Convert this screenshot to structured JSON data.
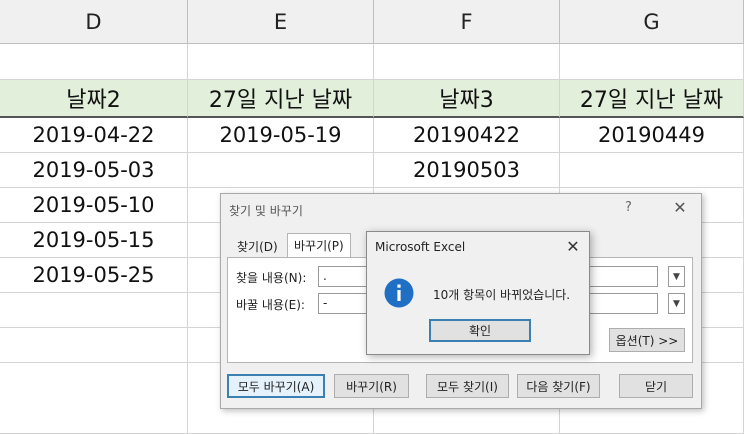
{
  "sheet": {
    "columns": [
      "D",
      "E",
      "F",
      "G"
    ],
    "headers": [
      "날짜2",
      "27일 지난 날짜",
      "날짜3",
      "27일 지난 날짜"
    ],
    "rows": [
      [
        "2019-04-22",
        "2019-05-19",
        "20190422",
        "20190449"
      ],
      [
        "2019-05-03",
        "",
        "20190503",
        ""
      ],
      [
        "2019-05-10",
        "",
        "",
        ""
      ],
      [
        "2019-05-15",
        "",
        "",
        ""
      ],
      [
        "2019-05-25",
        "",
        "",
        ""
      ],
      [
        "",
        "",
        "",
        ""
      ],
      [
        "",
        "",
        "",
        ""
      ],
      [
        "",
        "",
        "",
        ""
      ]
    ],
    "header_fill": "#e2efda"
  },
  "find_replace": {
    "title": "찾기 및 바꾸기",
    "help": "?",
    "tabs": [
      "찾기(D)",
      "바꾸기(P)"
    ],
    "find_label": "찾을 내용(N):",
    "find_value": ".",
    "replace_label": "바꿀 내용(E):",
    "replace_value": "-",
    "options_button": "옵션(T) >>",
    "buttons": {
      "replace_all": "모두 바꾸기(A)",
      "replace": "바꾸기(R)",
      "find_all": "모두 찾기(I)",
      "find_next": "다음 찾기(F)",
      "close": "닫기"
    }
  },
  "message_box": {
    "title": "Microsoft Excel",
    "message": "10개 항목이 바뀌었습니다.",
    "ok_label": "확인",
    "icon": "info-icon",
    "accent": "#1f6fc5"
  }
}
